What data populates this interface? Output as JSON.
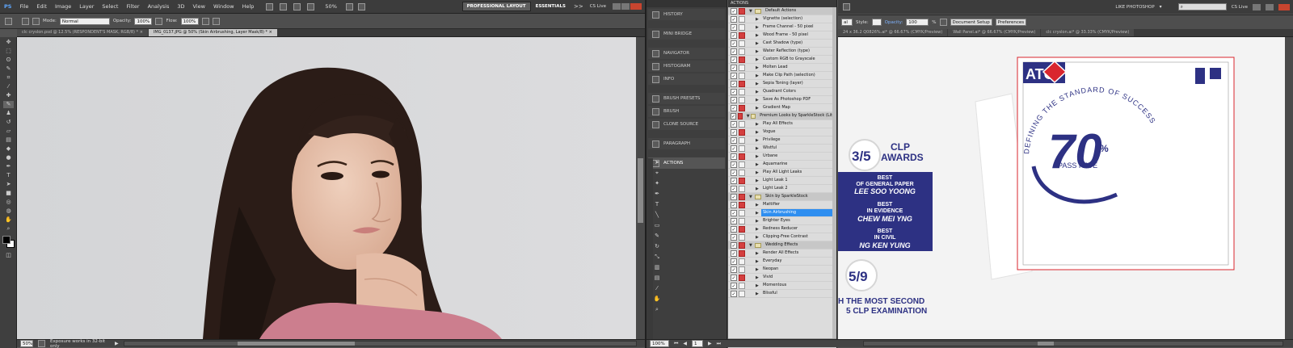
{
  "left_window": {
    "logo": "PS",
    "menu": [
      "File",
      "Edit",
      "Image",
      "Layer",
      "Select",
      "Filter",
      "Analysis",
      "3D",
      "View",
      "Window",
      "Help"
    ],
    "zoom": "50%",
    "workspace_buttons": [
      "PROFESSIONAL LAYOUT",
      "ESSENTIALS"
    ],
    "more": ">>",
    "cs_live": "CS Live",
    "options": {
      "mode_label": "Mode:",
      "mode_value": "Normal",
      "opacity_label": "Opacity:",
      "opacity_value": "100%",
      "flow_label": "Flow:",
      "flow_value": "100%"
    },
    "tabs": [
      {
        "label": "clc cryslon.psd @ 12.5% (RESPONDENT'S MASK, RGB/8) *",
        "close": "×"
      },
      {
        "label": "IMG_0137.JPG @ 50% (Skin Airbrushing, Layer Mask/8) *",
        "close": "×"
      }
    ],
    "status": {
      "zoom": "50%",
      "message": "Exposure works in 32-bit only"
    }
  },
  "right_window": {
    "options": {
      "style_label": "Style:",
      "opacity_label": "Opacity:",
      "opacity_value": "100",
      "document_setup": "Document Setup",
      "preferences": "Preferences"
    },
    "workspace": "LIKE PHOTOSHOP",
    "cs_live": "CS Live",
    "tabs": [
      "24 x 36.2 Q0826%.ai* @ 66.67% (CMYK/Preview)",
      "Wall Panel.ai* @ 66.67% (CMYK/Preview)",
      "clc cryslon.ai* @ 33.33% (CMYK/Preview)"
    ],
    "panels": [
      "HISTORY",
      "MINI BRIDGE",
      "NAVIGATOR",
      "HISTOGRAM",
      "INFO",
      "BRUSH PRESETS",
      "BRUSH",
      "CLONE SOURCE",
      "PARAGRAPH",
      "ACTIONS"
    ],
    "actions_title": "ACTIONS",
    "actions": [
      {
        "name": "Default Actions",
        "type": "set"
      },
      {
        "name": "Vignette (selection)"
      },
      {
        "name": "Frame Channel - 50 pixel"
      },
      {
        "name": "Wood Frame - 50 pixel"
      },
      {
        "name": "Cast Shadow (type)"
      },
      {
        "name": "Water Reflection (type)"
      },
      {
        "name": "Custom RGB to Grayscale"
      },
      {
        "name": "Molten Lead"
      },
      {
        "name": "Make Clip Path (selection)"
      },
      {
        "name": "Sepia Toning (layer)"
      },
      {
        "name": "Quadrant Colors"
      },
      {
        "name": "Save As Photoshop PDF"
      },
      {
        "name": "Gradient Map"
      },
      {
        "name": "Premium Looks by SparkleStock (Lite)",
        "type": "set"
      },
      {
        "name": "Play All Effects"
      },
      {
        "name": "Vogue"
      },
      {
        "name": "Privilege"
      },
      {
        "name": "Wistful"
      },
      {
        "name": "Urbane"
      },
      {
        "name": "Aquamarine"
      },
      {
        "name": "Play All Light Leaks"
      },
      {
        "name": "Light Leak 1"
      },
      {
        "name": "Light Leak 2"
      },
      {
        "name": "Skin by SparkleStock",
        "type": "set"
      },
      {
        "name": "Mattifier"
      },
      {
        "name": "Skin Airbrushing",
        "selected": true
      },
      {
        "name": "Brighter Eyes"
      },
      {
        "name": "Redness Reducer"
      },
      {
        "name": "Clipping-Free Contrast"
      },
      {
        "name": "Wedding Effects",
        "type": "set"
      },
      {
        "name": "Render All Effects"
      },
      {
        "name": "Everyday"
      },
      {
        "name": "Neopan"
      },
      {
        "name": "Vivid"
      },
      {
        "name": "Momentous"
      },
      {
        "name": "Blissful"
      }
    ],
    "artwork": {
      "fraction_1": "3/5",
      "clp": "CLP",
      "awards": "AWARDS",
      "awards_box": [
        {
          "line1": "BEST",
          "line2": "OF GENERAL PAPER",
          "name": "LEE SOO YOONG"
        },
        {
          "line1": "BEST",
          "line2": "IN EVIDENCE",
          "name": "CHEW MEI YNG"
        },
        {
          "line1": "BEST",
          "line2": "IN CIVIL",
          "name": "NG KEN YUNG"
        }
      ],
      "fraction_2": "5/9",
      "bottom_line1": "H THE MOST SECOND",
      "bottom_line2": "5 CLP EXAMINATION",
      "atc": "ATC",
      "big_number": "70",
      "percent": "%",
      "pass_rate": "PASS RATE",
      "arc_text": "DEFINING THE STANDARD OF SUCCESS"
    },
    "status": {
      "zoom": "100%",
      "page": "1"
    }
  },
  "colors": {
    "navy": "#2d3183",
    "red": "#d9262e",
    "highlight": "#2e8ef0"
  }
}
